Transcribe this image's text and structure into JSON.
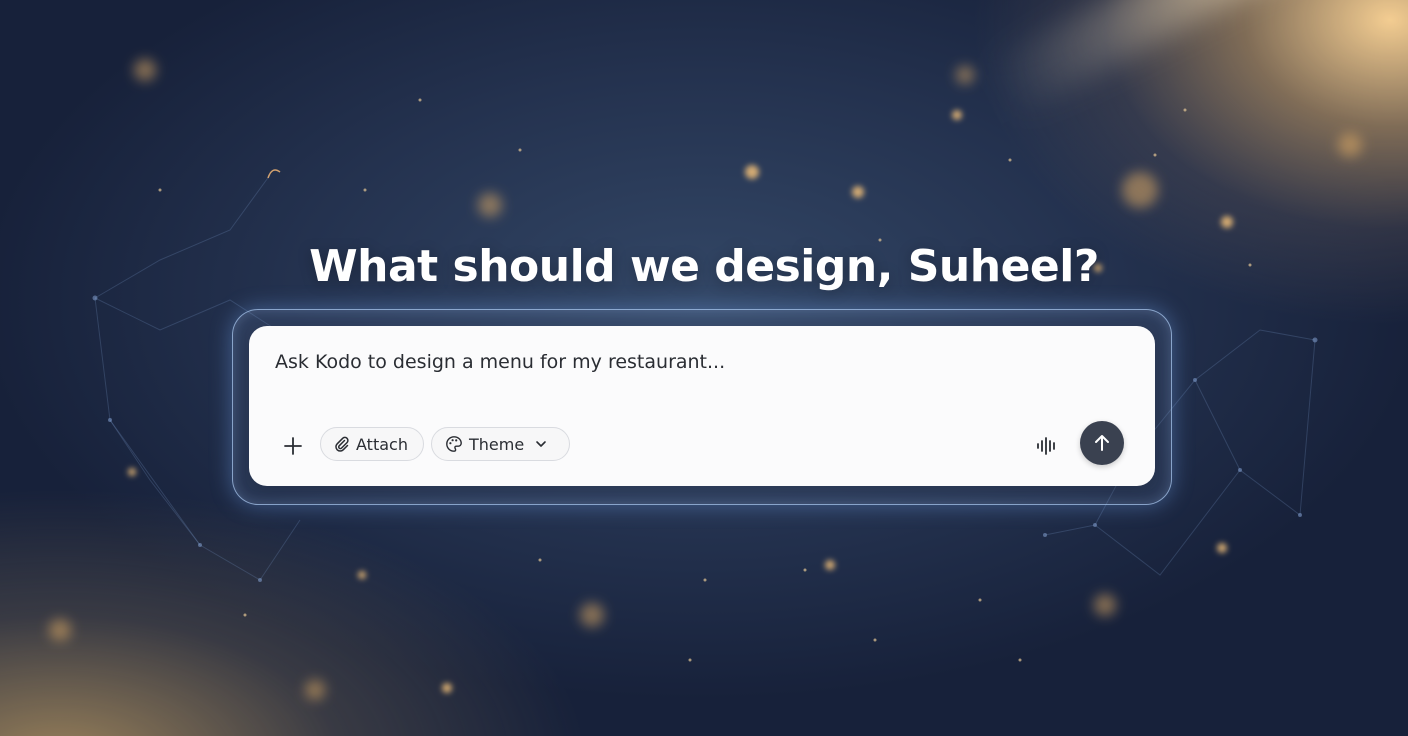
{
  "headline": "What should we design, Suheel?",
  "composer": {
    "placeholder": "Ask Kodo to design a menu for my restaurant...",
    "add_icon": "plus-icon",
    "attach": {
      "label": "Attach",
      "icon": "paperclip-icon"
    },
    "theme": {
      "label": "Theme",
      "icon": "palette-icon",
      "chevron_icon": "chevron-down-icon"
    },
    "voice_icon": "waveform-icon",
    "send_icon": "arrow-up-icon"
  },
  "colors": {
    "send_button": "#3a4150",
    "headline_text": "#ffffff",
    "composer_bg": "#fbfbfc",
    "glow_border": "#aac8f0"
  }
}
